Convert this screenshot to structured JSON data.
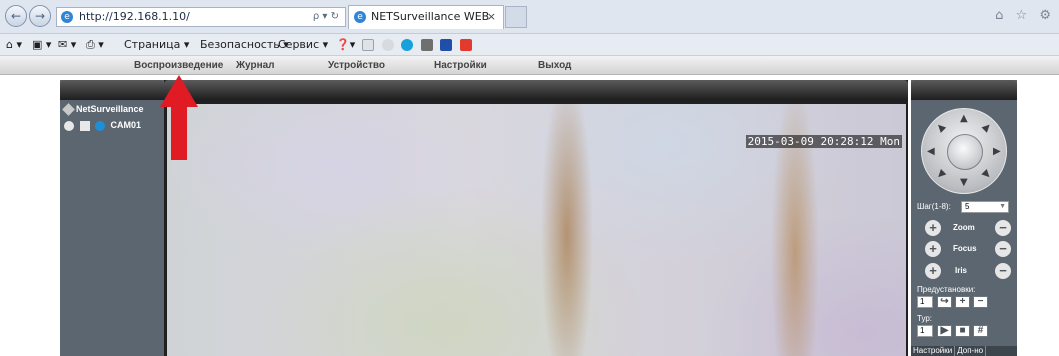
{
  "browser": {
    "address": "http://192.168.1.10/",
    "address_tools": "ρ ▾ ↻",
    "tab_title": "NETSurveillance WEB",
    "tab_close": "×",
    "right_icons": "⌂ ☆ ⚙"
  },
  "command_bar": {
    "home": "⌂ ▾",
    "feeds": "▣ ▾",
    "mail": "✉ ▾",
    "print": "⎙ ▾",
    "page": "Страница ▾",
    "security": "Безопасность ▾",
    "service": "Сервис ▾",
    "help": "❓▾"
  },
  "app_menu": {
    "items": [
      "Воспроизведение",
      "Журнал",
      "Устройство",
      "Настройки",
      "Выход"
    ]
  },
  "tree": {
    "root": "NetSurveillance",
    "camera": "CAM01"
  },
  "video": {
    "timestamp": "2015-03-09 20:28:12 Mon"
  },
  "ptz": {
    "step_label": "Шаг(1-8):",
    "step_value": "5",
    "zoom": "Zoom",
    "focus": "Focus",
    "iris": "Iris",
    "presets_label": "Предустановки:",
    "preset_value": "1",
    "tour_label": "Тур:",
    "tour_value": "1",
    "footer_left": "Настройки",
    "footer_right": "Доп-но"
  },
  "colors": {
    "annotation_arrow": "#e01b24",
    "panel_bg": "#5c6670"
  }
}
